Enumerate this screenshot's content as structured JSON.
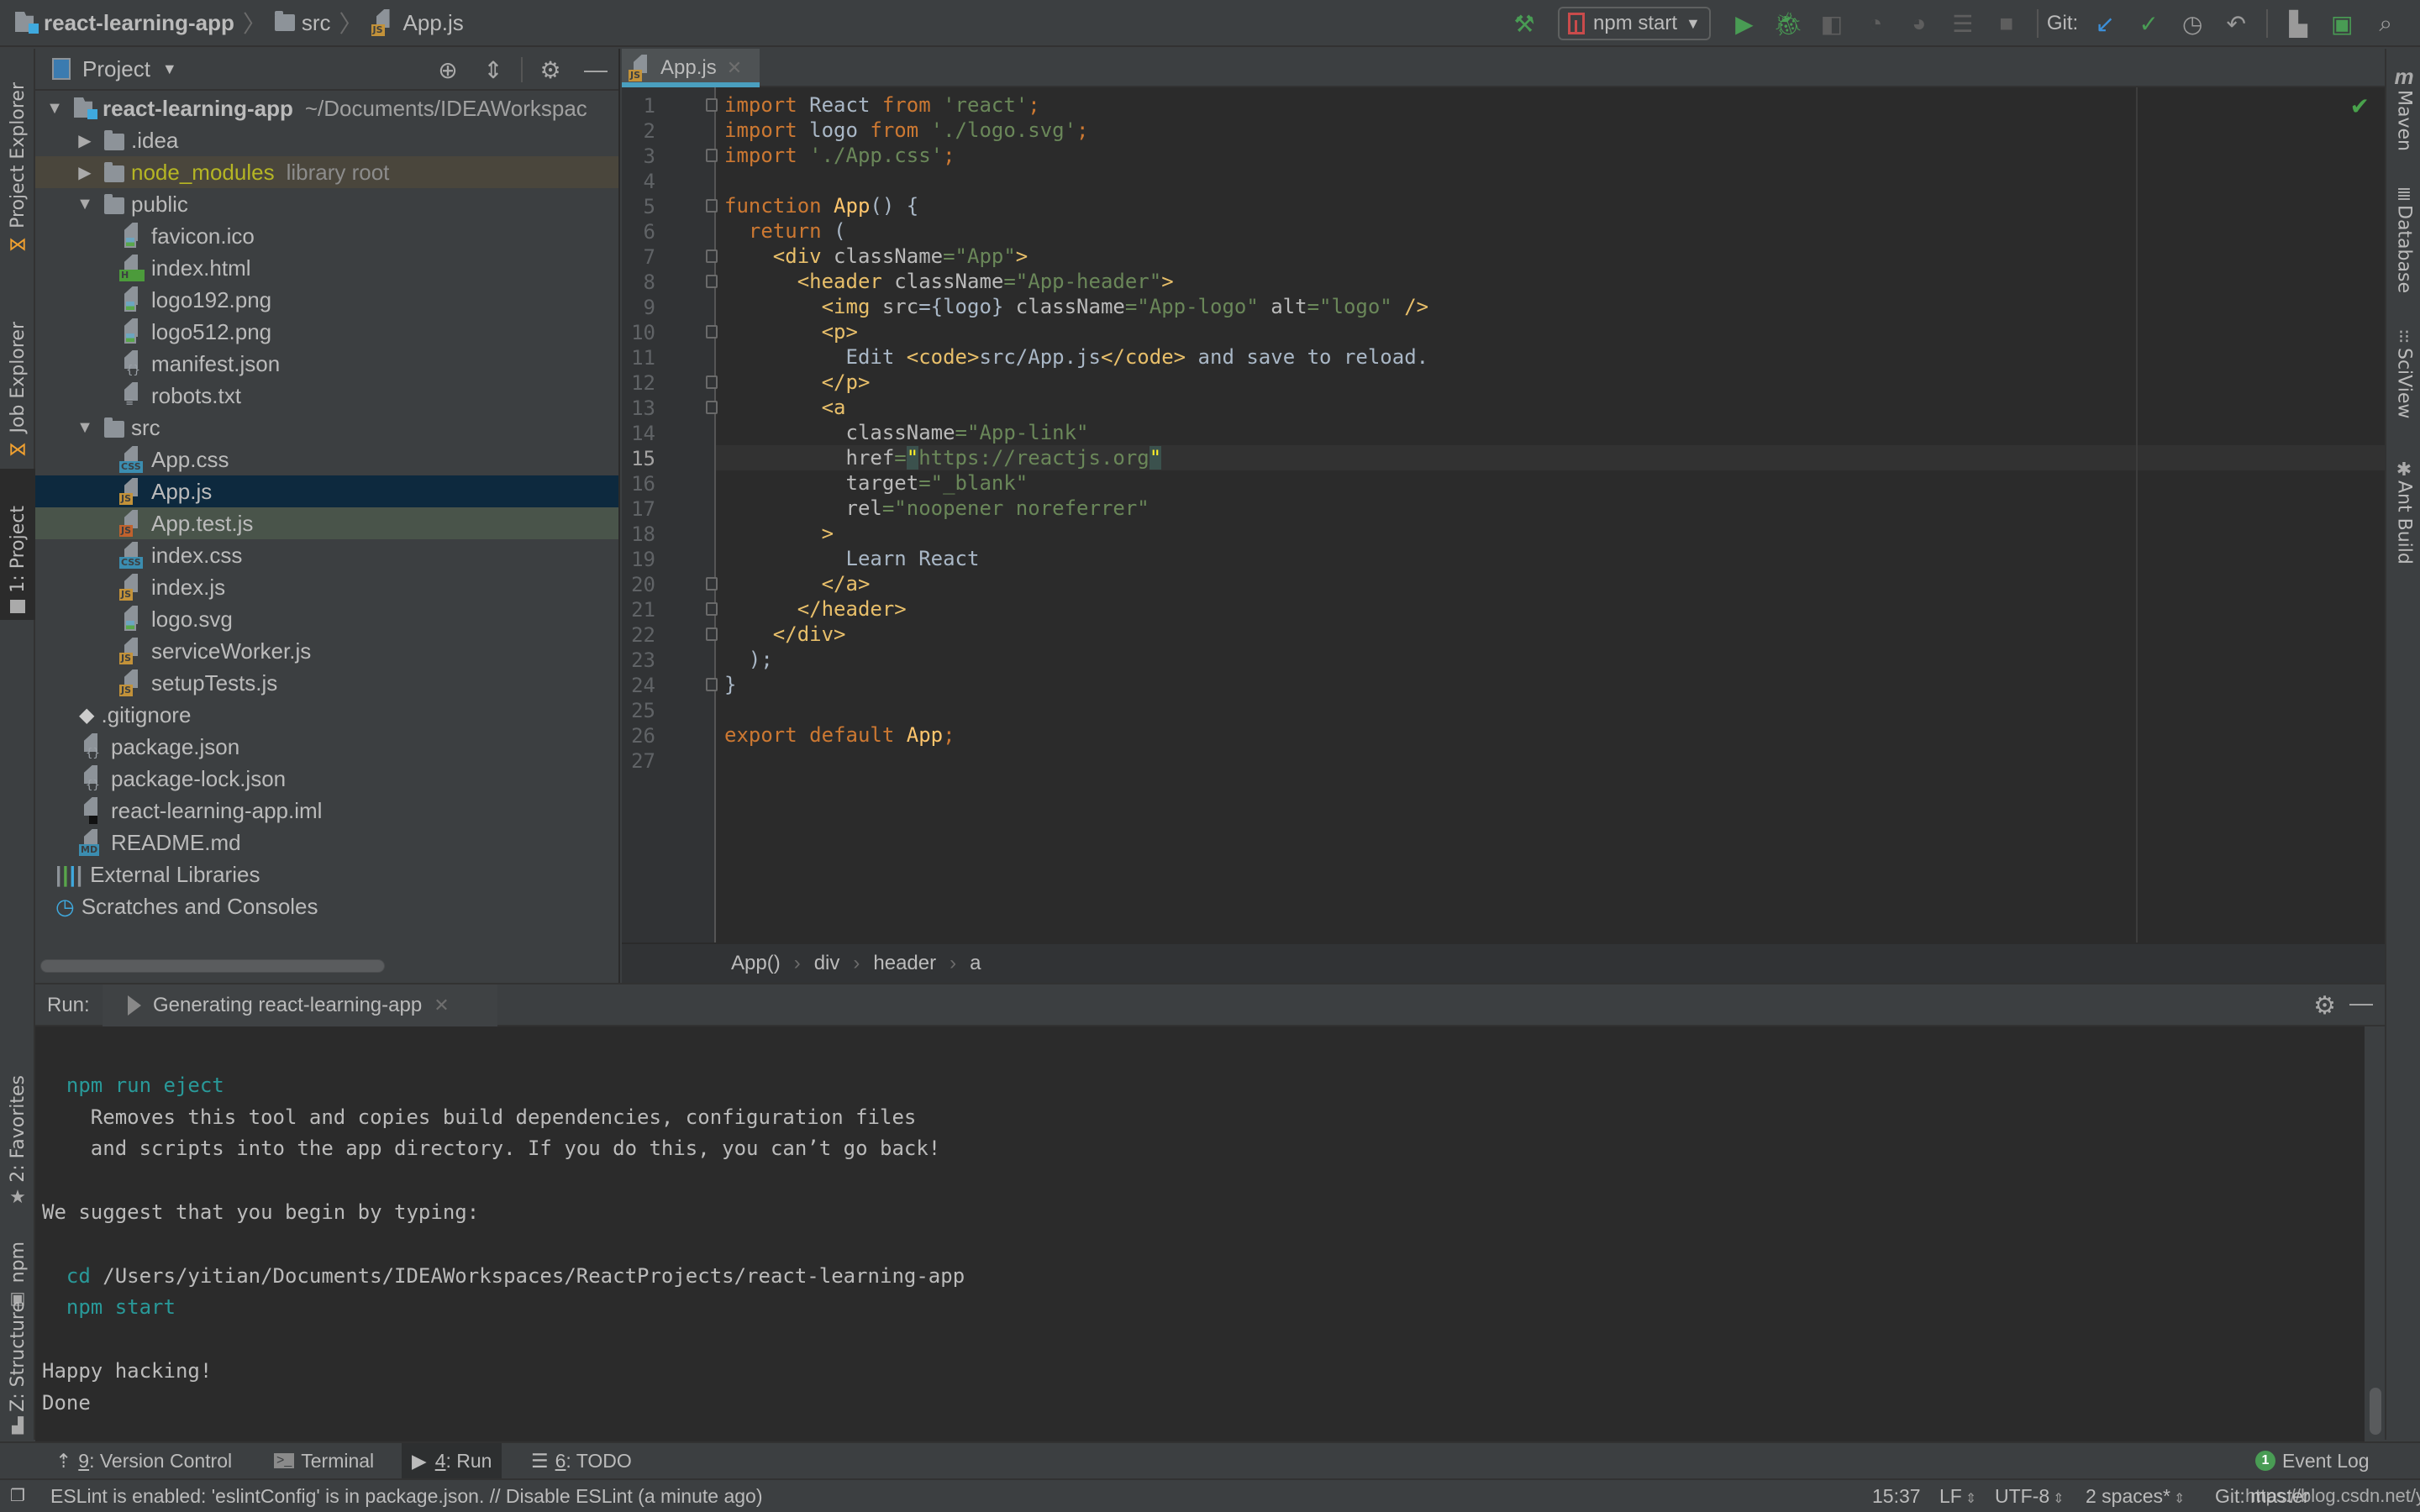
{
  "navbar": {
    "breadcrumb": [
      "react-learning-app",
      "src",
      "App.js"
    ],
    "run_config": "npm start",
    "git_label": "Git:"
  },
  "left_strip": {
    "tabs": [
      "Project Explorer",
      "Job Explorer",
      "1: Project",
      "2: Favorites",
      "npm",
      "Z: Structure"
    ]
  },
  "right_strip": {
    "tabs": [
      "Maven",
      "Database",
      "SciView",
      "Ant Build"
    ]
  },
  "project_panel": {
    "title": "Project",
    "tree": [
      {
        "label": "react-learning-app",
        "extra": "~/Documents/IDEAWorkspac",
        "type": "project",
        "depth": 0,
        "expanded": true
      },
      {
        "label": ".idea",
        "type": "folder",
        "depth": 1,
        "expanded": false
      },
      {
        "label": "node_modules",
        "extra": "library root",
        "type": "folder",
        "depth": 1,
        "expanded": false,
        "state": "library"
      },
      {
        "label": "public",
        "type": "folder",
        "depth": 1,
        "expanded": true
      },
      {
        "label": "favicon.ico",
        "type": "image",
        "depth": 2
      },
      {
        "label": "index.html",
        "type": "html",
        "depth": 2
      },
      {
        "label": "logo192.png",
        "type": "image",
        "depth": 2
      },
      {
        "label": "logo512.png",
        "type": "image",
        "depth": 2
      },
      {
        "label": "manifest.json",
        "type": "json",
        "depth": 2
      },
      {
        "label": "robots.txt",
        "type": "text",
        "depth": 2
      },
      {
        "label": "src",
        "type": "folder",
        "depth": 1,
        "expanded": true
      },
      {
        "label": "App.css",
        "type": "css",
        "depth": 2
      },
      {
        "label": "App.js",
        "type": "js",
        "depth": 2,
        "state": "selected"
      },
      {
        "label": "App.test.js",
        "type": "jstest",
        "depth": 2,
        "state": "test"
      },
      {
        "label": "index.css",
        "type": "css",
        "depth": 2
      },
      {
        "label": "index.js",
        "type": "js",
        "depth": 2
      },
      {
        "label": "logo.svg",
        "type": "image",
        "depth": 2
      },
      {
        "label": "serviceWorker.js",
        "type": "js",
        "depth": 2
      },
      {
        "label": "setupTests.js",
        "type": "js",
        "depth": 2
      },
      {
        "label": ".gitignore",
        "type": "git",
        "depth": 1
      },
      {
        "label": "package.json",
        "type": "json",
        "depth": 1
      },
      {
        "label": "package-lock.json",
        "type": "json",
        "depth": 1
      },
      {
        "label": "react-learning-app.iml",
        "type": "iml",
        "depth": 1
      },
      {
        "label": "README.md",
        "type": "md",
        "depth": 1
      },
      {
        "label": "External Libraries",
        "type": "libs",
        "depth": 0
      },
      {
        "label": "Scratches and Consoles",
        "type": "scratch",
        "depth": 0
      }
    ]
  },
  "editor": {
    "tab_label": "App.js",
    "current_line": 15,
    "lines": [
      [
        [
          "kw",
          "import "
        ],
        [
          "",
          "React "
        ],
        [
          "kw",
          "from "
        ],
        [
          "str",
          "'react'"
        ],
        [
          "kw",
          ";"
        ]
      ],
      [
        [
          "kw",
          "import "
        ],
        [
          "",
          "logo "
        ],
        [
          "kw",
          "from "
        ],
        [
          "str",
          "'./logo.svg'"
        ],
        [
          "kw",
          ";"
        ]
      ],
      [
        [
          "kw",
          "import "
        ],
        [
          "str",
          "'./App.css'"
        ],
        [
          "kw",
          ";"
        ]
      ],
      [],
      [
        [
          "kw",
          "function "
        ],
        [
          "fn",
          "App"
        ],
        [
          "",
          "() {"
        ]
      ],
      [
        [
          "",
          "  "
        ],
        [
          "kw",
          "return "
        ],
        [
          "",
          "("
        ]
      ],
      [
        [
          "",
          "    "
        ],
        [
          "tagc",
          "<div "
        ],
        [
          "attr",
          "className"
        ],
        [
          "str",
          "=\"App\""
        ],
        [
          "tagc",
          ">"
        ]
      ],
      [
        [
          "",
          "      "
        ],
        [
          "tagc",
          "<header "
        ],
        [
          "attr",
          "className"
        ],
        [
          "str",
          "=\"App-header\""
        ],
        [
          "tagc",
          ">"
        ]
      ],
      [
        [
          "",
          "        "
        ],
        [
          "tagc",
          "<img "
        ],
        [
          "attr",
          "src"
        ],
        [
          "",
          "={logo} "
        ],
        [
          "attr",
          "className"
        ],
        [
          "str",
          "=\"App-logo\" "
        ],
        [
          "attr",
          "alt"
        ],
        [
          "str",
          "=\"logo\" "
        ],
        [
          "tagc",
          "/>"
        ]
      ],
      [
        [
          "",
          "        "
        ],
        [
          "tagc",
          "<p>"
        ]
      ],
      [
        [
          "",
          "          Edit "
        ],
        [
          "tagc",
          "<code>"
        ],
        [
          "",
          "src/App.js"
        ],
        [
          "tagc",
          "</code>"
        ],
        [
          "",
          " and save to reload."
        ]
      ],
      [
        [
          "",
          "        "
        ],
        [
          "tagc",
          "</p>"
        ]
      ],
      [
        [
          "",
          "        "
        ],
        [
          "tagc",
          "<a"
        ]
      ],
      [
        [
          "",
          "          "
        ],
        [
          "attr",
          "className"
        ],
        [
          "str",
          "=\"App-link\""
        ]
      ],
      [
        [
          "",
          "          "
        ],
        [
          "attr",
          "href"
        ],
        [
          "str",
          "="
        ],
        [
          "bm",
          "\""
        ],
        [
          "str",
          "https://reactjs.org"
        ],
        [
          "bm",
          "\""
        ]
      ],
      [
        [
          "",
          "          "
        ],
        [
          "attr",
          "target"
        ],
        [
          "str",
          "=\"_blank\""
        ]
      ],
      [
        [
          "",
          "          "
        ],
        [
          "attr",
          "rel"
        ],
        [
          "str",
          "=\"noopener noreferrer\""
        ]
      ],
      [
        [
          "",
          "        "
        ],
        [
          "tagc",
          ">"
        ]
      ],
      [
        [
          "",
          "          Learn React"
        ]
      ],
      [
        [
          "",
          "        "
        ],
        [
          "tagc",
          "</a>"
        ]
      ],
      [
        [
          "",
          "      "
        ],
        [
          "tagc",
          "</header>"
        ]
      ],
      [
        [
          "",
          "    "
        ],
        [
          "tagc",
          "</div>"
        ]
      ],
      [
        [
          "",
          "  );"
        ]
      ],
      [
        [
          "",
          "}"
        ]
      ],
      [],
      [
        [
          "kw",
          "export default "
        ],
        [
          "fn",
          "App"
        ],
        [
          "kw",
          ";"
        ]
      ],
      []
    ],
    "fold_lines": [
      1,
      3,
      5,
      7,
      8,
      10,
      12,
      13,
      20,
      21,
      22,
      24
    ]
  },
  "breadcrumbs": [
    "App()",
    "div",
    "header",
    "a"
  ],
  "run_panel": {
    "label": "Run:",
    "tab_label": "Generating react-learning-app",
    "console": [
      {
        "row": 1,
        "parts": [
          [
            "cyan",
            "  npm run eject"
          ]
        ]
      },
      {
        "row": 2,
        "parts": [
          [
            "",
            "    Removes this tool and copies build dependencies, configuration files"
          ]
        ]
      },
      {
        "row": 3,
        "parts": [
          [
            "",
            "    and scripts into the app directory. If you do this, you can’t go back!"
          ]
        ]
      },
      {
        "row": 5,
        "parts": [
          [
            "",
            "We suggest that you begin by typing:"
          ]
        ]
      },
      {
        "row": 7,
        "parts": [
          [
            "cyan",
            "  cd"
          ],
          [
            "",
            " /Users/yitian/Documents/IDEAWorkspaces/ReactProjects/react-learning-app"
          ]
        ]
      },
      {
        "row": 8,
        "parts": [
          [
            "cyan",
            "  npm start"
          ]
        ]
      },
      {
        "row": 10,
        "parts": [
          [
            "",
            "Happy hacking!"
          ]
        ]
      },
      {
        "row": 11,
        "parts": [
          [
            "",
            "Done"
          ]
        ]
      }
    ]
  },
  "tool_windows": [
    {
      "key": "9",
      "label": ": Version Control",
      "icon": "version-control-icon"
    },
    {
      "key": "",
      "label": "Terminal",
      "icon": "terminal-icon"
    },
    {
      "key": "4",
      "label": ": Run",
      "icon": "run-icon",
      "active": true
    },
    {
      "key": "6",
      "label": ": TODO",
      "icon": "todo-icon"
    }
  ],
  "event_log": {
    "label": "Event Log",
    "count": "1"
  },
  "status_bar": {
    "message": "ESLint is enabled: 'eslintConfig' is in package.json. // Disable ESLint (a minute ago)",
    "position": "15:37",
    "line_sep": "LF",
    "encoding": "UTF-8",
    "indent": "2 spaces*",
    "vcs": "Git: master",
    "watermark": "https://blog.csdn.net/yitian_z"
  }
}
